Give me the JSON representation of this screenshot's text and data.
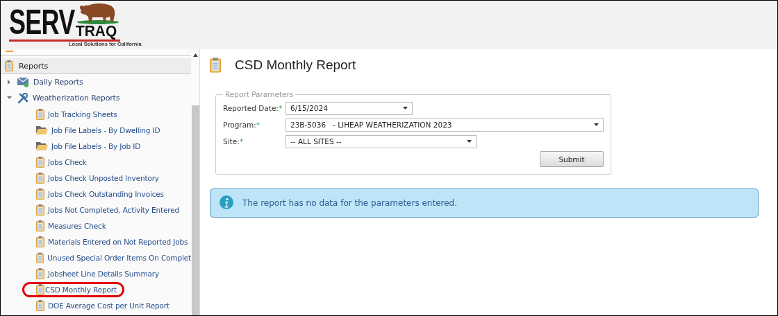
{
  "logo": {
    "word_1": "SERV",
    "word_2": "TRAQ",
    "tagline": "Local Solutions for California"
  },
  "sidebar": {
    "section": "Reports",
    "groups": [
      {
        "label": "Daily Reports",
        "kind": "envelope",
        "expanded": false
      },
      {
        "label": "Weatherization Reports",
        "kind": "tools",
        "expanded": true,
        "children": [
          {
            "label": "Job Tracking Sheets",
            "kind": "clipboard",
            "circled": false
          },
          {
            "label": "Job File Labels - By Dwelling ID",
            "kind": "folder",
            "circled": false
          },
          {
            "label": "Job File Labels - By Job ID",
            "kind": "folder",
            "circled": false
          },
          {
            "label": "Jobs Check",
            "kind": "clipboard",
            "circled": false
          },
          {
            "label": "Jobs Check Unposted Inventory",
            "kind": "clipboard",
            "circled": false
          },
          {
            "label": "Jobs Check Outstanding Invoices",
            "kind": "clipboard",
            "circled": false
          },
          {
            "label": "Jobs Not Completed, Activity Entered",
            "kind": "clipboard",
            "circled": false
          },
          {
            "label": "Measures Check",
            "kind": "clipboard",
            "circled": false
          },
          {
            "label": "Materials Entered on Not Reported Jobs",
            "kind": "clipboard",
            "circled": false
          },
          {
            "label": "Unused Special Order Items On Complet",
            "kind": "clipboard",
            "circled": false
          },
          {
            "label": "Jobsheet Line Details Summary",
            "kind": "clipboard",
            "circled": false
          },
          {
            "label": "CSD Monthly Report",
            "kind": "clipboard",
            "circled": true
          },
          {
            "label": "DOE Average Cost per Unit Report",
            "kind": "clipboard",
            "circled": false
          }
        ]
      }
    ]
  },
  "page": {
    "title": "CSD Monthly Report",
    "parameters": {
      "legend": "Report Parameters",
      "fields": [
        {
          "label": "Reported Date:",
          "required_mark": "*",
          "value": "6/15/2024"
        },
        {
          "label": "Program:",
          "required_mark": "*",
          "value": "23B-5036   - LIHEAP WEATHERIZATION 2023"
        },
        {
          "label": "Site:",
          "required_mark": "*",
          "value": "-- ALL SITES --"
        }
      ],
      "submit": "Submit"
    },
    "message": "The report has no data for the parameters entered."
  }
}
